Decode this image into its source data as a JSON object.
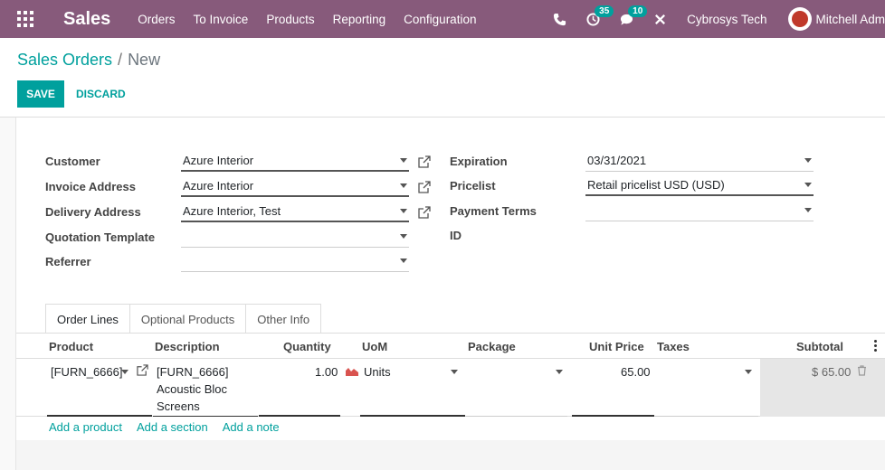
{
  "navbar": {
    "brand": "Sales",
    "menu": [
      "Orders",
      "To Invoice",
      "Products",
      "Reporting",
      "Configuration"
    ],
    "activity_count": "35",
    "messages_count": "10",
    "company": "Cybrosys Tech",
    "user": "Mitchell Adm",
    "accent_color": "#875a7b"
  },
  "breadcrumb": {
    "parent": "Sales Orders",
    "separator": "/",
    "current": "New"
  },
  "buttons": {
    "save": "SAVE",
    "discard": "DISCARD"
  },
  "form": {
    "customer": {
      "label": "Customer",
      "value": "Azure Interior"
    },
    "invoice_address": {
      "label": "Invoice Address",
      "value": "Azure Interior"
    },
    "delivery_address": {
      "label": "Delivery Address",
      "value": "Azure Interior, Test"
    },
    "quotation_template": {
      "label": "Quotation Template",
      "value": ""
    },
    "referrer": {
      "label": "Referrer",
      "value": ""
    },
    "expiration": {
      "label": "Expiration",
      "value": "03/31/2021"
    },
    "pricelist": {
      "label": "Pricelist",
      "value": "Retail pricelist USD (USD)"
    },
    "payment_terms": {
      "label": "Payment Terms",
      "value": ""
    },
    "id": {
      "label": "ID",
      "value": ""
    }
  },
  "tabs": [
    "Order Lines",
    "Optional Products",
    "Other Info"
  ],
  "table": {
    "columns": [
      "Product",
      "Description",
      "Quantity",
      "UoM",
      "Package",
      "Unit Price",
      "Taxes",
      "Subtotal"
    ],
    "row": {
      "product": "[FURN_6666]",
      "description_1": "[FURN_6666]",
      "description_2": "Acoustic Bloc",
      "description_3": "Screens",
      "quantity": "1.00",
      "uom": "Units",
      "package": "",
      "unit_price": "65.00",
      "taxes": "",
      "subtotal": "$ 65.00"
    },
    "add_links": [
      "Add a product",
      "Add a section",
      "Add a note"
    ]
  }
}
